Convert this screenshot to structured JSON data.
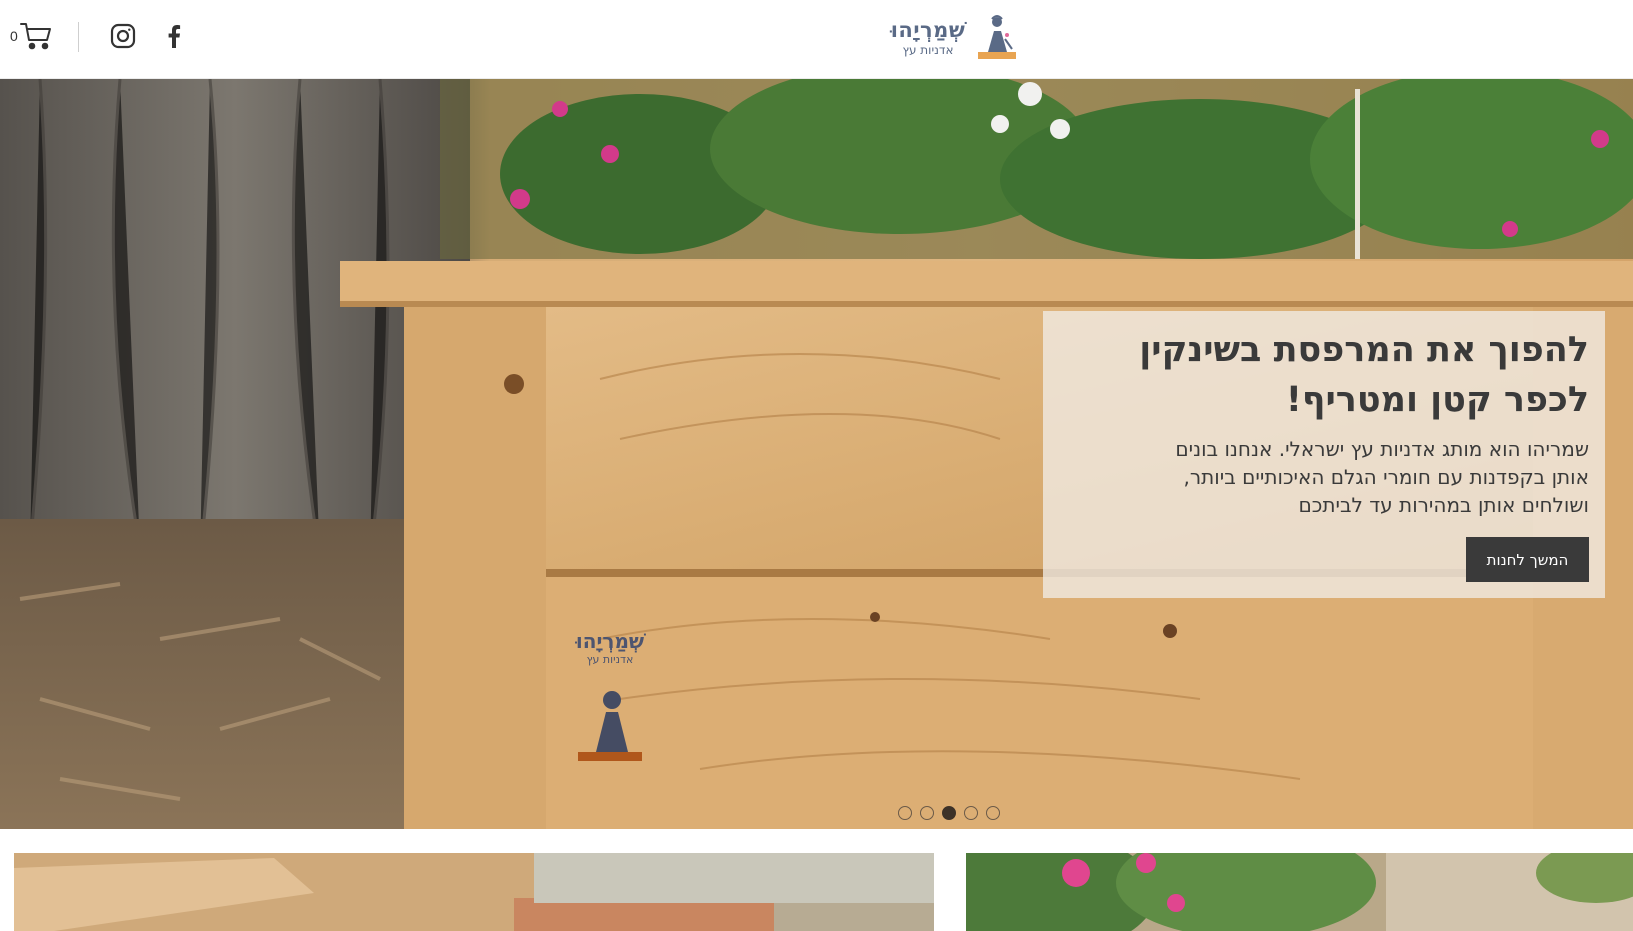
{
  "header": {
    "cart": {
      "count": "0",
      "icon": "cart-icon"
    },
    "social": [
      {
        "name": "instagram",
        "icon": "instagram-icon"
      },
      {
        "name": "facebook",
        "icon": "facebook-icon"
      }
    ],
    "logo": {
      "name": "שְׁמַרְיָהוּ",
      "subtitle": "אדניות עץ"
    }
  },
  "hero": {
    "title_line1": "להפוך את המרפסת בשינקין",
    "title_line2": "לכפר קטן ומטריף!",
    "desc_line1": "שמריהו הוא מותג אדניות עץ ישראלי. אנחנו בונים",
    "desc_line2": "אותן בקפדנות עם חומרי הגלם האיכותיים ביותר,",
    "desc_line3": "ושולחים אותן במהירות עד לביתכם",
    "button_label": "המשך לחנות",
    "planter_logo": {
      "name": "שְׁמַרְיָהוּ",
      "subtitle": "אדניות עץ"
    },
    "slides": {
      "count": 5,
      "active": 3
    }
  },
  "colors": {
    "text_dark": "#3a3a3a",
    "button_bg": "#3a3a3a",
    "logo_blue": "#5a6a86",
    "logo_orange": "#e8a452"
  }
}
